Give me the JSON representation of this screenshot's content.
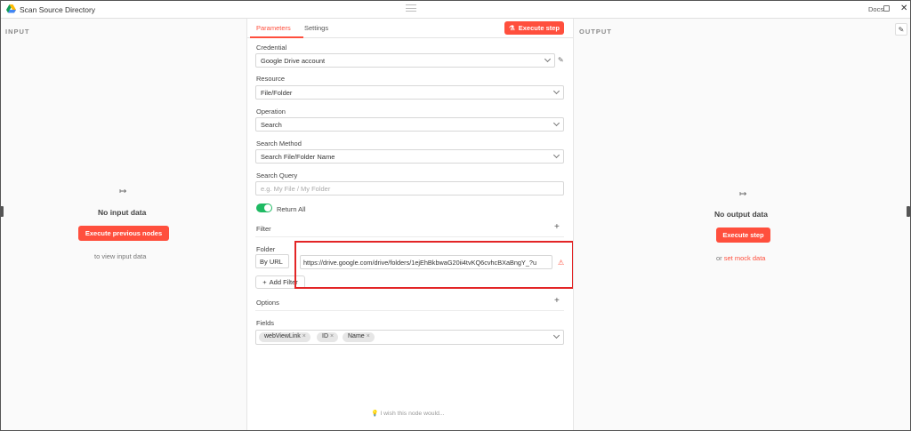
{
  "window": {
    "title": "Scan Source Directory",
    "docs_label": "Docs",
    "close_glyph": "✕",
    "icons": [
      "google-drive-icon",
      "external-link-icon",
      "close-icon",
      "drag-handle-icon"
    ]
  },
  "input_panel": {
    "title": "INPUT",
    "icon": "↦",
    "empty_title": "No input data",
    "button_label": "Execute previous nodes",
    "hint": "to view input data"
  },
  "output_panel": {
    "title": "OUTPUT",
    "icon": "↦",
    "empty_title": "No output data",
    "button_label": "Execute step",
    "hint_prefix": "or",
    "hint_link": "set mock data"
  },
  "tabs": {
    "parameters": "Parameters",
    "settings": "Settings",
    "execute_step": "Execute step"
  },
  "params": {
    "credential_label": "Credential",
    "credential_value": "Google Drive account",
    "resource_label": "Resource",
    "resource_value": "File/Folder",
    "operation_label": "Operation",
    "operation_value": "Search",
    "search_method_label": "Search Method",
    "search_method_value": "Search File/Folder Name",
    "search_query_label": "Search Query",
    "search_query_placeholder": "e.g. My File / My Folder",
    "return_all_label": "Return All",
    "return_all_enabled": true,
    "filter_label": "Filter",
    "folder_label": "Folder",
    "folder_mode": "By URL",
    "folder_url": "https://drive.google.com/drive/folders/1ejEhBkbwaG20ii4tvKQ6cvhcBXaBngY_?u",
    "add_filter_label": "Add Filter",
    "options_label": "Options",
    "fields_label": "Fields",
    "fields_chips": [
      "webViewLink",
      "ID",
      "Name"
    ],
    "wish_text": "I wish this node would..."
  },
  "colors": {
    "accent": "#ff4f3d",
    "toggle_on": "#1fba63",
    "highlight_box": "#e32526"
  }
}
